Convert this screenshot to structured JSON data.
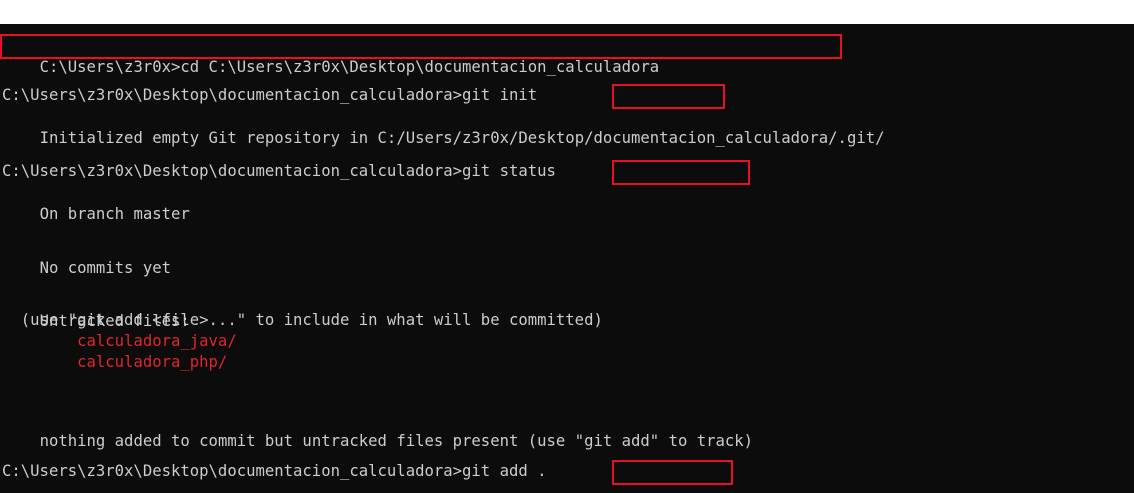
{
  "terminal": {
    "colors": {
      "background": "#0c0c0c",
      "text": "#cccccc",
      "untracked": "#e0252e",
      "highlight_box": "#e81123"
    },
    "lines": [
      {
        "prompt": "",
        "command": "C:\\Users\\z3r0x>cd C:\\Users\\z3r0x\\Desktop\\documentacion_calculadora"
      },
      {
        "prompt": "C:\\Users\\z3r0x\\Desktop\\documentacion_calculadora>",
        "command": "git init"
      },
      {
        "output": "Initialized empty Git repository in C:/Users/z3r0x/Desktop/documentacion_calculadora/.git/"
      },
      {
        "prompt": "C:\\Users\\z3r0x\\Desktop\\documentacion_calculadora>",
        "command": "git status"
      },
      {
        "output": "On branch master"
      },
      {
        "output": "No commits yet"
      },
      {
        "output": "Untracked files:"
      },
      {
        "output": "  (use \"git add <file>...\" to include in what will be committed)"
      },
      {
        "untracked": "calculadora_java/"
      },
      {
        "untracked": "calculadora_php/"
      },
      {
        "output": "nothing added to commit but untracked files present (use \"git add\" to track)"
      },
      {
        "prompt": "C:\\Users\\z3r0x\\Desktop\\documentacion_calculadora>",
        "command": "git add ."
      }
    ]
  }
}
